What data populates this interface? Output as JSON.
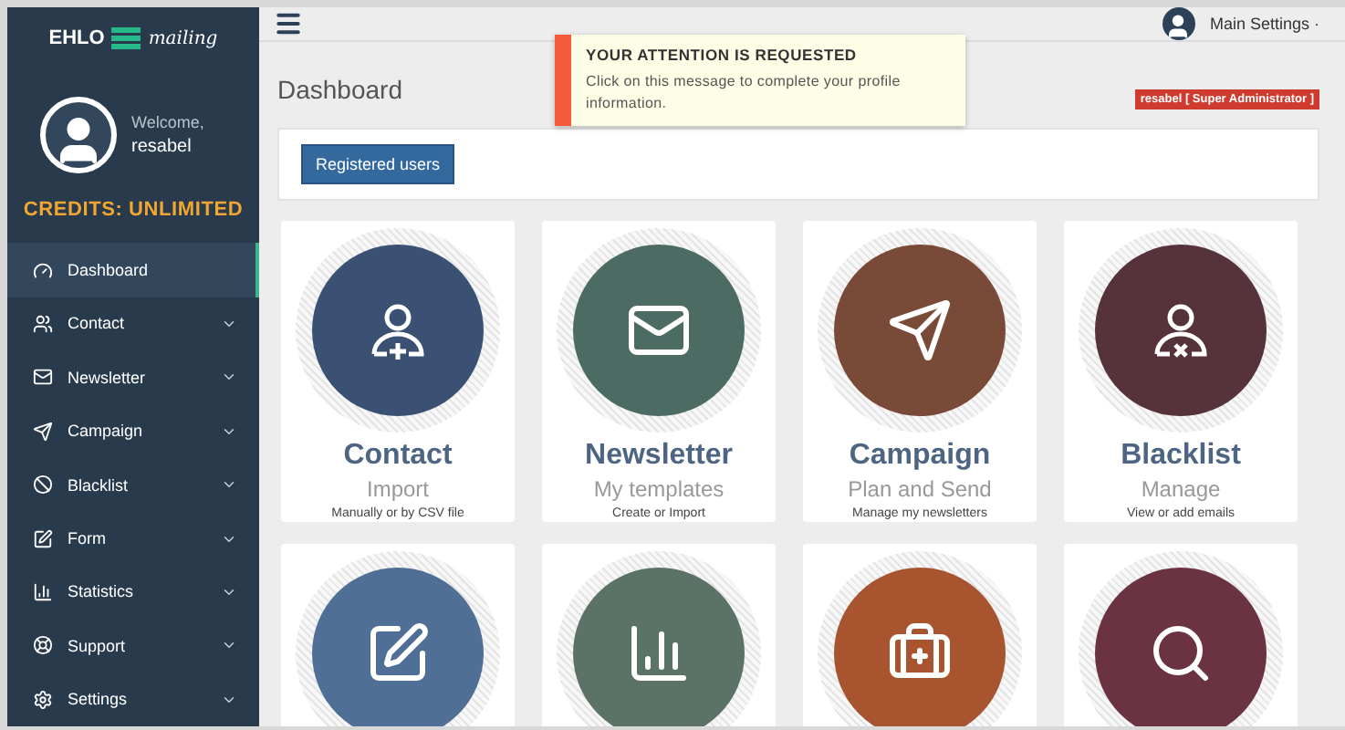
{
  "sidebar": {
    "logo": {
      "left": "EHLO",
      "right": "mailing"
    },
    "welcome": "Welcome,",
    "username": "resabel",
    "credits": "CREDITS: UNLIMITED",
    "items": [
      {
        "label": "Dashboard",
        "selected": true,
        "expandable": false
      },
      {
        "label": "Contact",
        "selected": false,
        "expandable": true
      },
      {
        "label": "Newsletter",
        "selected": false,
        "expandable": true
      },
      {
        "label": "Campaign",
        "selected": false,
        "expandable": true
      },
      {
        "label": "Blacklist",
        "selected": false,
        "expandable": true
      },
      {
        "label": "Form",
        "selected": false,
        "expandable": true
      },
      {
        "label": "Statistics",
        "selected": false,
        "expandable": true
      },
      {
        "label": "Support",
        "selected": false,
        "expandable": true
      },
      {
        "label": "Settings",
        "selected": false,
        "expandable": true
      }
    ]
  },
  "topbar": {
    "settings": "Main Settings ·"
  },
  "notification": {
    "title": "YOUR ATTENTION IS REQUESTED",
    "message": "Click on this message to complete your profile information."
  },
  "page": {
    "title": "Dashboard",
    "user_badge": "resabel [ Super Administrator ]",
    "button": "Registered users"
  },
  "cards": [
    {
      "title": "Contact",
      "subtitle": "Import",
      "note": "Manually or by CSV file",
      "color": "#3a5173"
    },
    {
      "title": "Newsletter",
      "subtitle": "My templates",
      "note": "Create or Import",
      "color": "#4c6b63"
    },
    {
      "title": "Campaign",
      "subtitle": "Plan and Send",
      "note": "Manage my newsletters",
      "color": "#7a4a38"
    },
    {
      "title": "Blacklist",
      "subtitle": "Manage",
      "note": "View or add emails",
      "color": "#56323a"
    },
    {
      "color": "#4f6f96"
    },
    {
      "color": "#5b7366"
    },
    {
      "color": "#a8542e"
    },
    {
      "color": "#6b3242"
    }
  ]
}
